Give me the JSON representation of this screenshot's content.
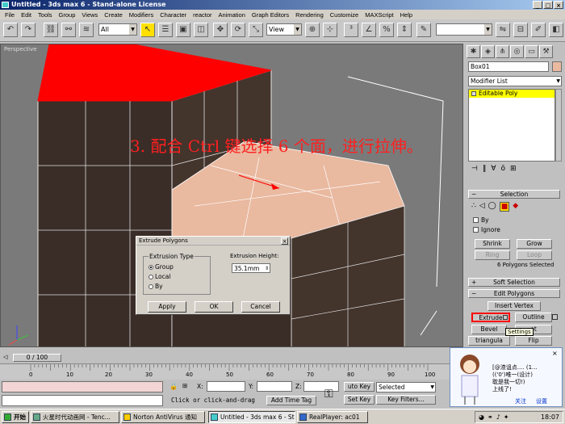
{
  "window": {
    "title": "Untitled - 3ds max 6 - Stand-alone License"
  },
  "menu": [
    "File",
    "Edit",
    "Tools",
    "Group",
    "Views",
    "Create",
    "Modifiers",
    "Character",
    "reactor",
    "Animation",
    "Graph Editors",
    "Rendering",
    "Customize",
    "MAXScript",
    "Help"
  ],
  "toolbar": {
    "filter_value": "All",
    "coord_value": "View"
  },
  "viewport": {
    "label": "Perspective",
    "instruction": "3. 配合 Ctrl 键选择 6 个面，进行拉伸。"
  },
  "dialog": {
    "title": "Extrude Polygons",
    "type_label": "Extrusion Type",
    "options": [
      "Group",
      "Local",
      "By"
    ],
    "selected_option": "Group",
    "height_label": "Extrusion Height:",
    "height_value": "35.1mm",
    "apply": "Apply",
    "ok": "OK",
    "cancel": "Cancel"
  },
  "panel": {
    "object_name": "Box01",
    "modifier_list": "Modifier List",
    "stack_item": "Editable Poly",
    "selection_title": "Selection",
    "by_vertex": "By",
    "ignore": "Ignore",
    "shrink": "Shrink",
    "grow": "Grow",
    "ring": "Ring",
    "loop": "Loop",
    "selected_status": "6 Polygons Selected",
    "soft_selection": "Soft Selection",
    "edit_polygons": "Edit Polygons",
    "insert_vertex": "Insert Vertex",
    "extrude": "Extrude",
    "outline": "Outline",
    "bevel": "Bevel",
    "inset": "et",
    "tooltip": "Settings",
    "triangulate": "triangula",
    "flip": "Flip"
  },
  "timeline": {
    "frame_label": "0 / 100",
    "ticks": [
      "0",
      "10",
      "20",
      "30",
      "40",
      "50",
      "60",
      "70",
      "80",
      "90",
      "100"
    ]
  },
  "status": {
    "x_label": "X:",
    "y_label": "Y:",
    "z_label": "Z:",
    "prompt": "Click or click-and-drag",
    "add_time_tag": "Add Time Tag",
    "auto_key": "uto Key",
    "set_key": "Set Key",
    "selected": "Selected",
    "key_filters": "Key Filters..."
  },
  "taskbar": {
    "start": "开始",
    "tasks": [
      "火星时代动画网 - Tenc...",
      "Norton AntiVirus 通知",
      "Untitled - 3ds max 6 - St...",
      "RealPlayer: ac01"
    ],
    "clock": "18:07"
  },
  "popup": {
    "line1": "[@渣诅点.... (1...",
    "line2": "(('0')唯一(设计)",
    "line3": "耽是我一切!)",
    "line4": "上线了!",
    "link1": "关注",
    "link2": "设置"
  },
  "colors": {
    "selected_face": "#ff0000",
    "highlight_face": "#e9b9a0",
    "box_face": "#3a2d27",
    "modifier_highlight": "#ffff00"
  }
}
